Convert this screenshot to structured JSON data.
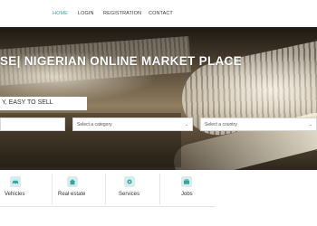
{
  "nav": {
    "items": [
      {
        "label": "HOME",
        "active": true
      },
      {
        "label": "LOGIN",
        "active": false
      },
      {
        "label": "REGISTRATION",
        "active": false
      },
      {
        "label": "CONTACT",
        "active": false
      }
    ]
  },
  "hero": {
    "title": "SE| NIGERIAN ONLINE MARKET PLACE",
    "subtitle": "Y, EASY TO SELL"
  },
  "search": {
    "category_select": "Select a category",
    "country_select": "Select a country"
  },
  "categories": [
    {
      "label": "Vehicles",
      "icon": "car-icon"
    },
    {
      "label": "Real estate",
      "icon": "house-icon"
    },
    {
      "label": "Services",
      "icon": "gear-icon"
    },
    {
      "label": "Jobs",
      "icon": "briefcase-icon"
    }
  ],
  "colors": {
    "accent": "#35a7a1",
    "icon_bg": "#d8ecea"
  }
}
